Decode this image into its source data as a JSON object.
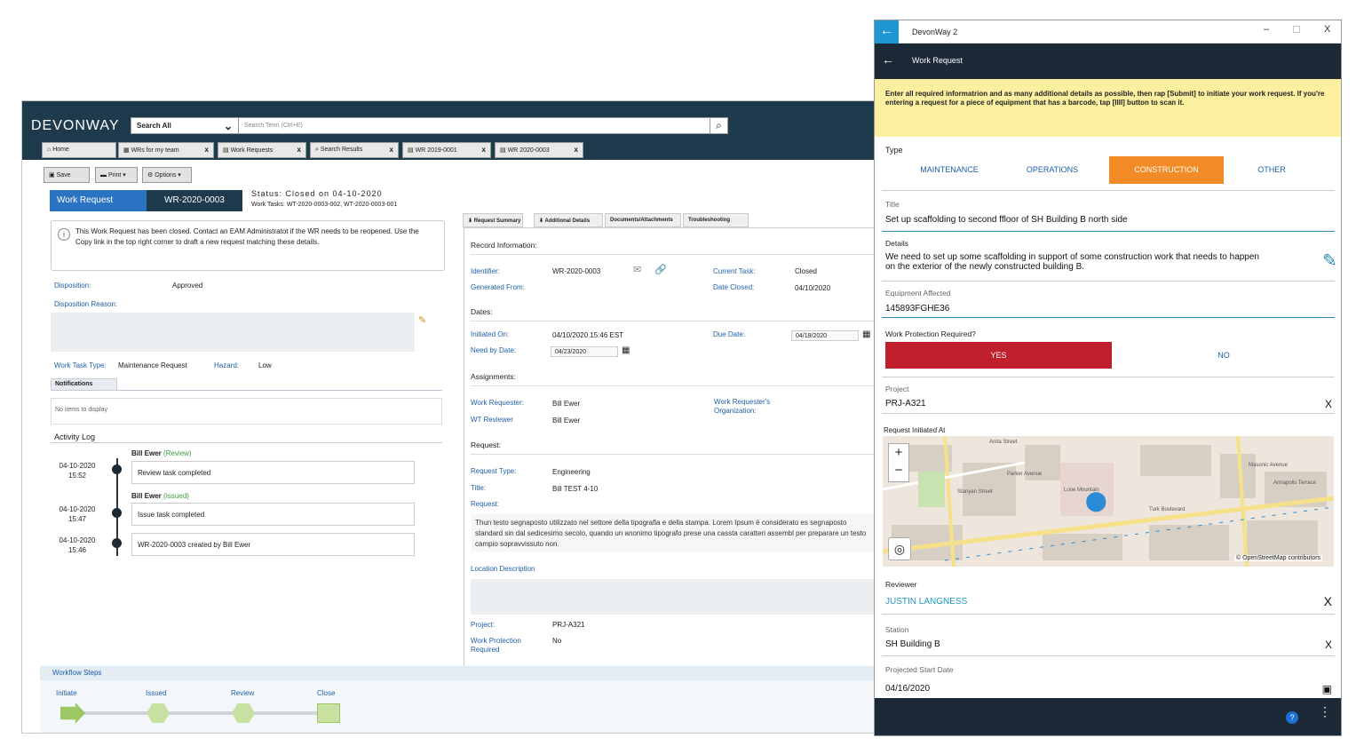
{
  "desktop": {
    "logo": "DEVONWAY",
    "search_scope": "Search All",
    "search_placeholder": "Search Term (Ctrl+E)",
    "tabs": [
      "Home",
      "WRs for my team",
      "Work Requests",
      "Search Results",
      "WR 2019-0001",
      "WR 2020-0003"
    ],
    "toolbar": {
      "save": "Save",
      "print": "Print ▾",
      "options": "Options ▾"
    },
    "breadcrumb": {
      "type": "Work Request",
      "id": "WR-2020-0003"
    },
    "status": "Status:  Closed on 04-10-2020",
    "work_tasks_label": "Work Tasks:",
    "work_tasks": "WT-2020-0003-002, WT-2020-0003-001",
    "notice": "This Work Request has been closed. Contact an EAM Administratot if the WR needs to be reopened. Use the Copy link in the top right corner to draft a new request matching these details.",
    "disposition_label": "Disposition:",
    "disposition": "Approved",
    "disposition_reason_label": "Disposition Reason:",
    "work_task_type_label": "Work Task Type:",
    "work_task_type": "Maintenance Request",
    "hazard_label": "Hazard:",
    "hazard": "Low",
    "notifications_tab": "Notifications",
    "notifications_empty": "No items to display",
    "activity_log_title": "Activity Log",
    "activity": [
      {
        "name": "Bill Ewer",
        "role": "(Review)",
        "date": "04-10-2020",
        "time": "15:52",
        "text": "Review task completed"
      },
      {
        "name": "Bill Ewer",
        "role": "(Issued)",
        "date": "04-10-2020",
        "time": "15:47",
        "text": "Issue task completed"
      },
      {
        "name": "",
        "role": "",
        "date": "04-10-2020",
        "time": "15:46",
        "text": "WR-2020-0003 created by Bill Ewer"
      }
    ],
    "right_tabs": [
      "Request Summary",
      "Additional Details",
      "Documents/Attachments",
      "Troubleshooting"
    ],
    "record_info": "Record Information:",
    "identifier_label": "Identifier:",
    "identifier": "WR-2020-0003",
    "generated_from_label": "Generated From:",
    "current_task_label": "Current Task:",
    "current_task": "Closed",
    "date_closed_label": "Date Closed:",
    "date_closed": "04/10/2020",
    "dates_title": "Dates:",
    "initiated_on_label": "Initiated On:",
    "initiated_on": "04/10/2020 15:46 EST",
    "need_by_label": "Need by Date:",
    "need_by": "04/23/2020",
    "due_date_label": "Due Date:",
    "due_date": "04/19/2020",
    "assignments_title": "Assignments:",
    "work_requester_label": "Work Requester:",
    "work_requester": "Bill Ewer",
    "wt_reviewer_label": "WT Reviewer",
    "wt_reviewer": "Bill Ewer",
    "requester_org_label": "Work Requester's Organization:",
    "request_title": "Request:",
    "request_type_label": "Request Type:",
    "request_type": "Engineering",
    "title_label": "Title:",
    "title": "Bill TEST 4-10",
    "request_label": "Request:",
    "request_text": "Thun testo segnaposto utilizzato nel settore della tipografia e della stampa. Lorem Ipsum è considerato es segnaposto standard sin dal sedicesimo secolo, quando un anonimo tipografo prese una cassta caratteri assembl per preparare un testo campio sopravvissuto non.",
    "location_label": "Location Description",
    "project_label": "Project:",
    "project": "PRJ-A321",
    "wp_required_label": "Work Protection Required",
    "wp_required": "No",
    "workflow_title": "Workflow Steps",
    "workflow_steps": [
      "Initiate",
      "Issued",
      "Review",
      "Close"
    ]
  },
  "mobile": {
    "app_title": "DevonWay 2",
    "window_controls": [
      "–",
      "☐",
      "X"
    ],
    "header_title": "Work Request",
    "instructions": "Enter all required informatrion and as many additional details as possible, then rap [Submit] to initiate your work request. If you're entering a request for a piece of equipment that has a barcode, tap [IIII] button to scan it.",
    "type_label": "Type",
    "types": [
      "MAINTENANCE",
      "OPERATIONS",
      "CONSTRUCTION",
      "OTHER"
    ],
    "selected_type": "CONSTRUCTION",
    "title_label": "Title",
    "title": "Set up scaffolding to second ffloor of SH Building B north side",
    "details_label": "Details",
    "details": "We need to set up some scaffolding in support of some construction work that needs to happen on the exterior of the newly constructed building B.",
    "equipment_label": "Equipment Affected",
    "equipment": "145893FGHE36",
    "wp_label": "Work Protection Required?",
    "wp_yes": "YES",
    "wp_no": "NO",
    "project_label": "Project",
    "project": "PRJ-A321",
    "clear": "X",
    "map_label": "Request Initiated At",
    "map_attribution": "© OpenStreetMap contributors",
    "map_streets": [
      "Anita Street",
      "Turk Boulevard",
      "Stanyan Street",
      "Lone Mountain",
      "Masonic Avenue",
      "Parker Avenue",
      "Annapolis Terrace"
    ],
    "reviewer_label": "Reviewer",
    "reviewer": "JUSTIN LANGNESS",
    "station_label": "Station",
    "station": "SH Building B",
    "start_date_label": "Projected Start Date",
    "start_date": "04/16/2020",
    "accent": "#f28a25",
    "yes_color": "#c0202c"
  }
}
